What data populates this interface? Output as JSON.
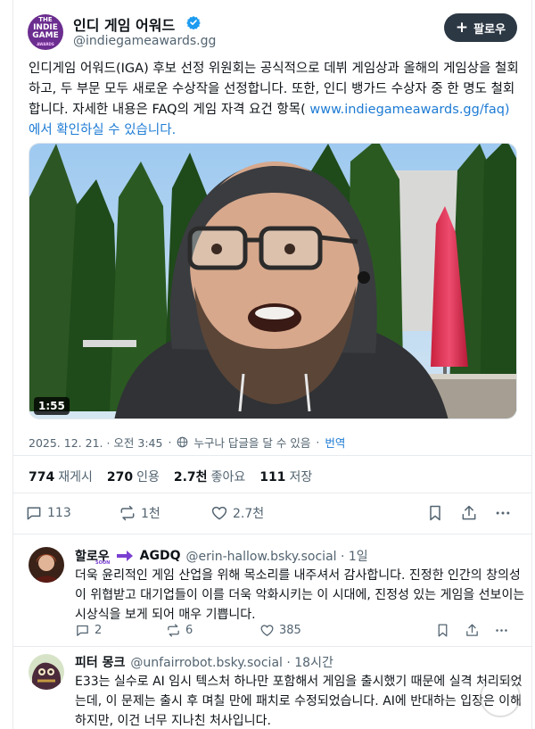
{
  "post": {
    "display_name": "인디 게임 어워드",
    "handle": "@indiegameawards.gg",
    "avatar_text": [
      "THE",
      "INDIE GAME",
      "AWARDS"
    ],
    "follow_label": "팔로우",
    "text_main": "인디게임 어워드(IGA) 후보 선정 위원회는 공식적으로 데뷔 게임상과 올해의 게임상을 철회하고, 두 부문 모두 새로운 수상작을 선정합니다. 또한, 인디 뱅가드 수상자 중 한 명도 철회합니다. 자세한 내용은 FAQ의 게임 자격 요건 항목(",
    "text_link": "www.indiegameawards.gg/faq) 에서 확인하실 수 있습니다.",
    "video_duration": "1:55",
    "timestamp": "2025. 12. 21. · 오전 3:45",
    "reply_setting": "누구나 답글을 달 수 있음",
    "translate": "번역",
    "stats": {
      "reposts_value": "774",
      "reposts_label": "재게시",
      "quotes_value": "270",
      "quotes_label": "인용",
      "likes_value": "2.7천",
      "likes_label": "좋아요",
      "saves_value": "111",
      "saves_label": "저장"
    },
    "actions": {
      "replies": "113",
      "reposts": "1천",
      "likes": "2.7천"
    }
  },
  "replies": [
    {
      "name": "할로우",
      "badge_text": "SOON",
      "name_suffix": "AGDQ",
      "handle": "@erin-hallow.bsky.social · 1일",
      "text": "더욱 윤리적인 게임 산업을 위해 목소리를 내주셔서 감사합니다. 진정한 인간의 창의성이 위협받고 대기업들이 이를 더욱 악화시키는 이 시대에, 진정성 있는 게임을 선보이는 시상식을 보게 되어 매우 기쁩니다.",
      "replies": "2",
      "reposts": "6",
      "likes": "385"
    },
    {
      "name": "피터 몽크",
      "handle": "@unfairrobot.bsky.social · 18시간",
      "text": "E33는 실수로 AI 임시 텍스처 하나만 포함해서 게임을 출시했기 때문에 실격 처리되었는데, 이 문제는 출시 후 며칠 만에 패치로 수정되었습니다. AI에 반대하는 입장은 이해하지만, 이건 너무 지나친 처사입니다."
    }
  ],
  "colors": {
    "link": "#1d7bd4",
    "follow_bg": "#2d3845",
    "verified": "#1d9bf0",
    "muted": "#536471"
  }
}
